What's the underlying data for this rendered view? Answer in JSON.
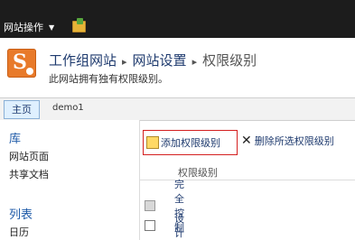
{
  "ribbon": {
    "site_actions": "网站操作"
  },
  "header": {
    "crumb_site": "工作组网站",
    "crumb_settings": "网站设置",
    "crumb_current": "权限级别",
    "description": "此网站拥有独有权限级别。"
  },
  "topnav": {
    "home": "主页",
    "demo": "demo1"
  },
  "leftnav": {
    "lib_head": "库",
    "lib_items": [
      "网站页面",
      "共享文档"
    ],
    "list_head": "列表",
    "list_items": [
      "日历"
    ]
  },
  "toolbar": {
    "add": "添加权限级别",
    "delete": "删除所选权限级别"
  },
  "table": {
    "column": "权限级别",
    "rows": [
      {
        "name": "完全控制",
        "disabled": true
      },
      {
        "name": "设计",
        "disabled": false
      }
    ]
  }
}
